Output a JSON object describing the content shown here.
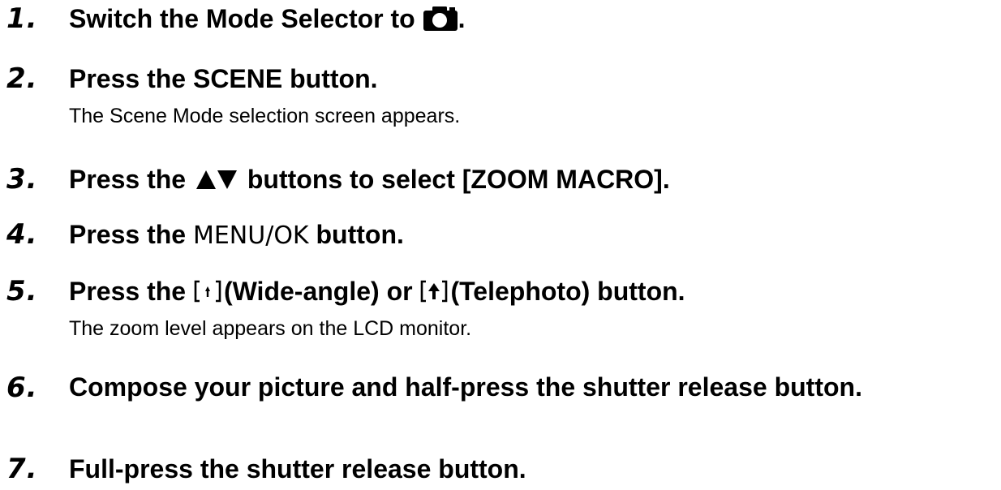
{
  "steps": [
    {
      "number": "1.",
      "title_before": "Switch the Mode Selector to",
      "icon": "camera-icon",
      "title_after": "."
    },
    {
      "number": "2.",
      "title": "Press the SCENE button.",
      "note": "The Scene Mode selection screen appears."
    },
    {
      "number": "3.",
      "title_before": "Press the",
      "icon": "up-down-arrows-icon",
      "title_after": "buttons to select [ZOOM MACRO]."
    },
    {
      "number": "4.",
      "title_before": "Press the",
      "button_label": "MENU/OK",
      "title_after": "button."
    },
    {
      "number": "5.",
      "title_before": "Press the",
      "icon_1": "zoom-wide-icon",
      "title_middle": "(Wide-angle) or",
      "icon_2": "zoom-tele-icon",
      "title_after": "(Telephoto) button.",
      "note": "The zoom level appears on the LCD monitor."
    },
    {
      "number": "6.",
      "title": "Compose your picture and half-press the shutter release button."
    },
    {
      "number": "7.",
      "title": "Full-press the shutter release button."
    }
  ]
}
